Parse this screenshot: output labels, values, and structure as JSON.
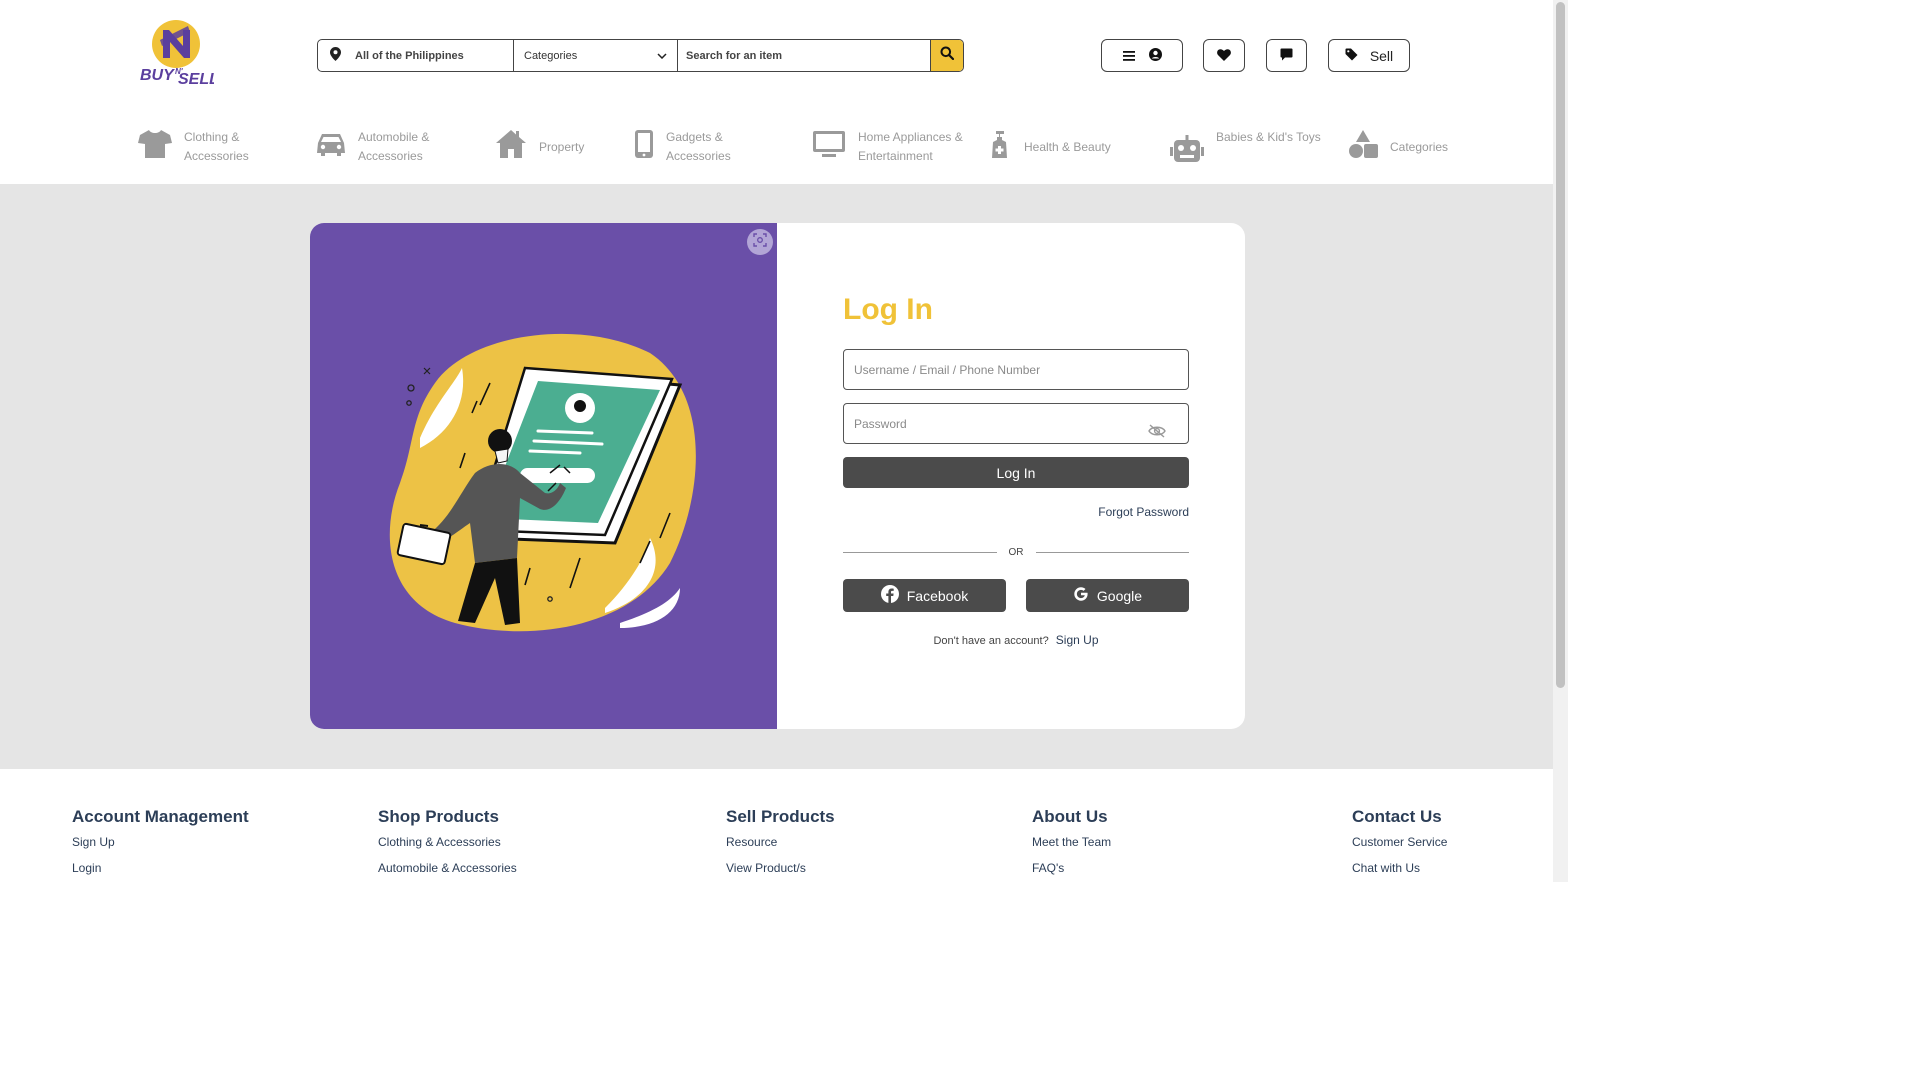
{
  "brand": {
    "logo_text_1": "BUY",
    "logo_text_2": "N'",
    "logo_text_3": "SELL"
  },
  "search": {
    "location": "All of the Philippines",
    "category": "Categories",
    "placeholder": "Search for an item"
  },
  "header_actions": {
    "sell_label": "Sell"
  },
  "categories": [
    {
      "line1": "Clothing &",
      "line2": "Accessories"
    },
    {
      "line1": "Automobile &",
      "line2": "Accessories"
    },
    {
      "line1": "Property",
      "line2": ""
    },
    {
      "line1": "Gadgets &",
      "line2": "Accessories"
    },
    {
      "line1": "Home Appliances &",
      "line2": "Entertainment"
    },
    {
      "line1": "Health & Beauty",
      "line2": ""
    },
    {
      "line1": "Babies & Kid's Toys",
      "line2": ""
    },
    {
      "line1": "Categories",
      "line2": ""
    }
  ],
  "login": {
    "title": "Log In",
    "username_placeholder": "Username / Email / Phone Number",
    "password_placeholder": "Password",
    "login_button": "Log In",
    "forgot": "Forgot Password",
    "or": "OR",
    "facebook": "Facebook",
    "google": "Google",
    "no_account": "Don't have an account?",
    "signup": "Sign Up"
  },
  "footer": {
    "columns": [
      {
        "title": "Account Management",
        "items": [
          "Sign Up",
          "Login"
        ]
      },
      {
        "title": "Shop Products",
        "items": [
          "Clothing & Accessories",
          "Automobile & Accessories"
        ]
      },
      {
        "title": "Sell Products",
        "items": [
          "Resource",
          "View Product/s"
        ]
      },
      {
        "title": "About Us",
        "items": [
          "Meet the Team",
          "FAQ's"
        ]
      },
      {
        "title": "Contact Us",
        "items": [
          "Customer Service",
          "Chat with Us"
        ]
      }
    ]
  },
  "colors": {
    "accent": "#f0c238",
    "purple": "#6a4fa8",
    "dark_button": "#4b4b4b",
    "footer_text": "#2c3e57"
  }
}
